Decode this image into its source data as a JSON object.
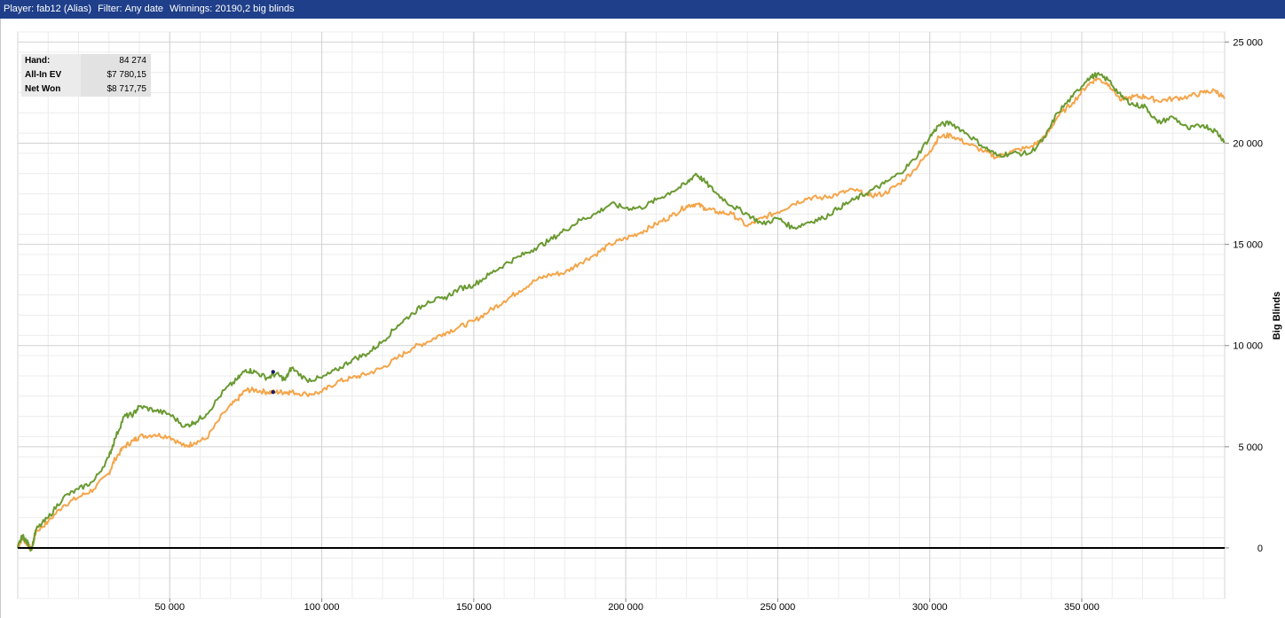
{
  "header": {
    "player_label": "Player:",
    "player_value": "fab12 (Alias)",
    "filter_label": "Filter:",
    "filter_value": "Any date",
    "winnings_label": "Winnings:",
    "winnings_value": "20190,2 big blinds"
  },
  "stats": [
    {
      "label": "Hand:",
      "value": "84 274"
    },
    {
      "label": "All-In EV",
      "value": "$7 780,15"
    },
    {
      "label": "Net Won",
      "value": "$8 717,75"
    }
  ],
  "colors": {
    "net_won": "#6a9a32",
    "all_in_ev": "#f5a54a",
    "zero_line": "#000000",
    "header_bg": "#1f3f8a"
  },
  "chart_data": {
    "type": "line",
    "xlabel": "",
    "ylabel": "Big Blinds",
    "xlim": [
      0,
      397000
    ],
    "ylim": [
      -2500,
      25500
    ],
    "x_ticks": [
      50000,
      100000,
      150000,
      200000,
      250000,
      300000,
      350000
    ],
    "x_tick_labels": [
      "50 000",
      "100 000",
      "150 000",
      "200 000",
      "250 000",
      "300 000",
      "350 000"
    ],
    "y_ticks": [
      0,
      5000,
      10000,
      15000,
      20000,
      25000
    ],
    "y_tick_labels": [
      "0",
      "5 000",
      "10 000",
      "15 000",
      "20 000",
      "25 000"
    ],
    "y_axis_position": "right",
    "grid": true,
    "series": [
      {
        "color": "#6a9a32",
        "points": [
          [
            0,
            0
          ],
          [
            1500,
            600
          ],
          [
            3000,
            300
          ],
          [
            4500,
            -100
          ],
          [
            6000,
            900
          ],
          [
            10000,
            1500
          ],
          [
            15000,
            2500
          ],
          [
            20000,
            2900
          ],
          [
            25000,
            3300
          ],
          [
            30000,
            4500
          ],
          [
            32000,
            5400
          ],
          [
            35000,
            6500
          ],
          [
            38000,
            6600
          ],
          [
            40000,
            7000
          ],
          [
            45000,
            6800
          ],
          [
            50000,
            6600
          ],
          [
            55000,
            6000
          ],
          [
            58000,
            6200
          ],
          [
            62000,
            6600
          ],
          [
            68000,
            7800
          ],
          [
            72000,
            8300
          ],
          [
            75000,
            8800
          ],
          [
            78000,
            8700
          ],
          [
            82000,
            8400
          ],
          [
            85000,
            8600
          ],
          [
            88000,
            8300
          ],
          [
            90000,
            8900
          ],
          [
            95000,
            8300
          ],
          [
            100000,
            8400
          ],
          [
            105000,
            8800
          ],
          [
            110000,
            9300
          ],
          [
            115000,
            9600
          ],
          [
            120000,
            10200
          ],
          [
            125000,
            11000
          ],
          [
            130000,
            11600
          ],
          [
            135000,
            12200
          ],
          [
            140000,
            12300
          ],
          [
            145000,
            12800
          ],
          [
            150000,
            13000
          ],
          [
            155000,
            13500
          ],
          [
            160000,
            14000
          ],
          [
            165000,
            14400
          ],
          [
            170000,
            14800
          ],
          [
            175000,
            15200
          ],
          [
            180000,
            15700
          ],
          [
            185000,
            16200
          ],
          [
            190000,
            16500
          ],
          [
            195000,
            17000
          ],
          [
            200000,
            16800
          ],
          [
            205000,
            16800
          ],
          [
            210000,
            17200
          ],
          [
            215000,
            17600
          ],
          [
            220000,
            18000
          ],
          [
            223000,
            18500
          ],
          [
            226000,
            18100
          ],
          [
            230000,
            17500
          ],
          [
            235000,
            16900
          ],
          [
            240000,
            16500
          ],
          [
            245000,
            16000
          ],
          [
            250000,
            16300
          ],
          [
            255000,
            15800
          ],
          [
            260000,
            16100
          ],
          [
            265000,
            16300
          ],
          [
            270000,
            16800
          ],
          [
            275000,
            17200
          ],
          [
            280000,
            17600
          ],
          [
            285000,
            18000
          ],
          [
            290000,
            18500
          ],
          [
            295000,
            19200
          ],
          [
            300000,
            20300
          ],
          [
            303000,
            20900
          ],
          [
            307000,
            21000
          ],
          [
            312000,
            20500
          ],
          [
            318000,
            19800
          ],
          [
            322000,
            19400
          ],
          [
            327000,
            19500
          ],
          [
            333000,
            19500
          ],
          [
            338000,
            20300
          ],
          [
            342000,
            21500
          ],
          [
            347000,
            22300
          ],
          [
            352000,
            23200
          ],
          [
            355000,
            23400
          ],
          [
            359000,
            23100
          ],
          [
            363000,
            22300
          ],
          [
            367000,
            21900
          ],
          [
            371000,
            21800
          ],
          [
            375000,
            21000
          ],
          [
            380000,
            21300
          ],
          [
            385000,
            20700
          ],
          [
            390000,
            20900
          ],
          [
            394000,
            20600
          ],
          [
            397000,
            20100
          ]
        ]
      },
      {
        "color": "#f5a54a",
        "points": [
          [
            0,
            0
          ],
          [
            1500,
            500
          ],
          [
            3000,
            200
          ],
          [
            4500,
            -100
          ],
          [
            6000,
            800
          ],
          [
            10000,
            1300
          ],
          [
            15000,
            2100
          ],
          [
            20000,
            2500
          ],
          [
            25000,
            2900
          ],
          [
            30000,
            3700
          ],
          [
            32000,
            4400
          ],
          [
            35000,
            5000
          ],
          [
            38000,
            5300
          ],
          [
            40000,
            5500
          ],
          [
            45000,
            5600
          ],
          [
            50000,
            5500
          ],
          [
            55000,
            5000
          ],
          [
            58000,
            5200
          ],
          [
            62000,
            5400
          ],
          [
            68000,
            6700
          ],
          [
            72000,
            7300
          ],
          [
            75000,
            7800
          ],
          [
            78000,
            7800
          ],
          [
            82000,
            7700
          ],
          [
            85000,
            7700
          ],
          [
            88000,
            7700
          ],
          [
            90000,
            7700
          ],
          [
            95000,
            7600
          ],
          [
            100000,
            7700
          ],
          [
            105000,
            8200
          ],
          [
            110000,
            8400
          ],
          [
            115000,
            8600
          ],
          [
            120000,
            8900
          ],
          [
            125000,
            9400
          ],
          [
            130000,
            9900
          ],
          [
            135000,
            10200
          ],
          [
            140000,
            10600
          ],
          [
            145000,
            10900
          ],
          [
            150000,
            11200
          ],
          [
            155000,
            11700
          ],
          [
            160000,
            12200
          ],
          [
            165000,
            12700
          ],
          [
            170000,
            13200
          ],
          [
            175000,
            13500
          ],
          [
            180000,
            13600
          ],
          [
            185000,
            14100
          ],
          [
            190000,
            14500
          ],
          [
            195000,
            15000
          ],
          [
            200000,
            15300
          ],
          [
            205000,
            15600
          ],
          [
            210000,
            16000
          ],
          [
            215000,
            16400
          ],
          [
            220000,
            16900
          ],
          [
            223000,
            17000
          ],
          [
            226000,
            16800
          ],
          [
            230000,
            16600
          ],
          [
            235000,
            16500
          ],
          [
            240000,
            15900
          ],
          [
            245000,
            16300
          ],
          [
            250000,
            16600
          ],
          [
            255000,
            17000
          ],
          [
            260000,
            17300
          ],
          [
            265000,
            17300
          ],
          [
            270000,
            17500
          ],
          [
            275000,
            17700
          ],
          [
            280000,
            17400
          ],
          [
            285000,
            17500
          ],
          [
            290000,
            18000
          ],
          [
            295000,
            18700
          ],
          [
            300000,
            19600
          ],
          [
            303000,
            20300
          ],
          [
            307000,
            20400
          ],
          [
            312000,
            20000
          ],
          [
            318000,
            19600
          ],
          [
            322000,
            19300
          ],
          [
            327000,
            19600
          ],
          [
            333000,
            19800
          ],
          [
            338000,
            20300
          ],
          [
            342000,
            21300
          ],
          [
            347000,
            22000
          ],
          [
            352000,
            22900
          ],
          [
            355000,
            23200
          ],
          [
            359000,
            22900
          ],
          [
            363000,
            22100
          ],
          [
            367000,
            22300
          ],
          [
            371000,
            22300
          ],
          [
            375000,
            22100
          ],
          [
            380000,
            22200
          ],
          [
            385000,
            22300
          ],
          [
            390000,
            22500
          ],
          [
            394000,
            22600
          ],
          [
            397000,
            22200
          ]
        ]
      }
    ],
    "markers": [
      {
        "x": 84000,
        "y": 8700
      },
      {
        "x": 84000,
        "y": 7700
      }
    ]
  }
}
